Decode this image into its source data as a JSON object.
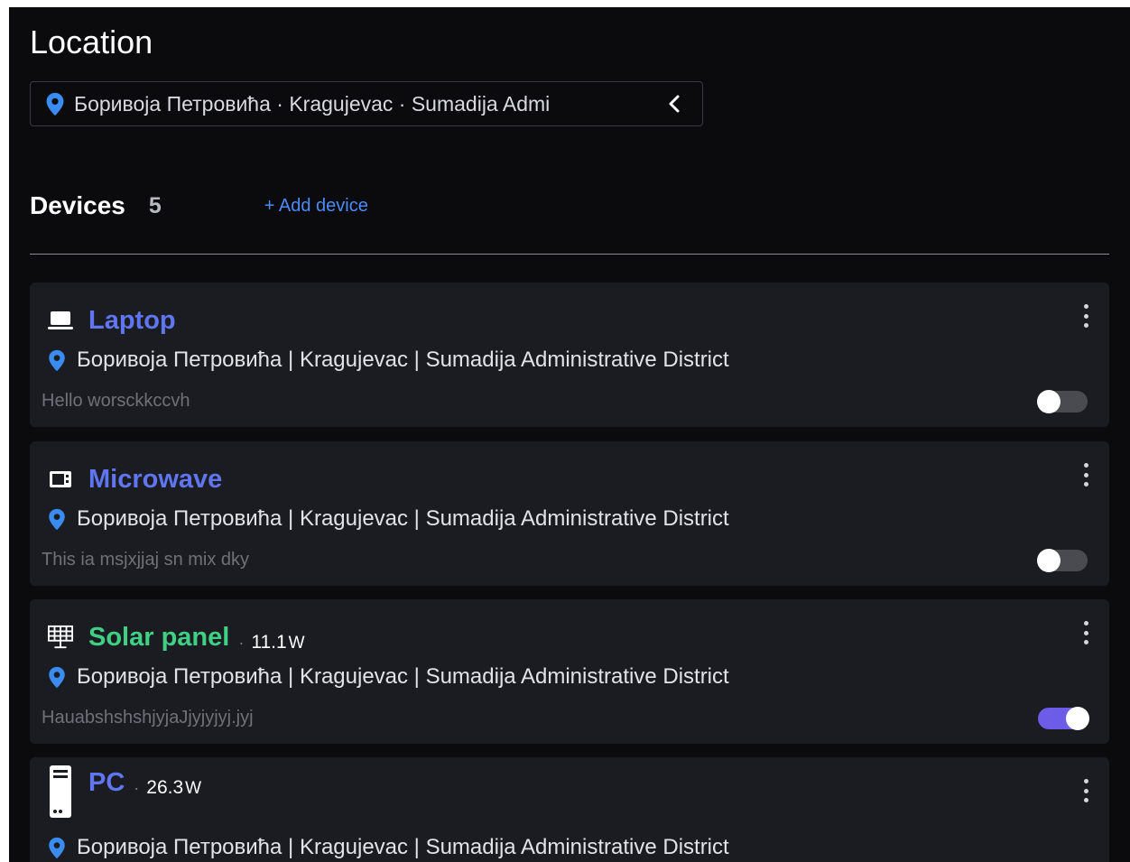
{
  "header": {
    "title": "Location"
  },
  "location_select": {
    "value": "Боривоја Петровића · Kragujevac · Sumadija Admi"
  },
  "devices": {
    "title": "Devices",
    "count": "5",
    "add_label": "+ Add device",
    "items": [
      {
        "name": "Laptop",
        "icon": "laptop-icon",
        "name_color": "#5f76f0",
        "address": "Боривоја Петровића | Kragujevac | Sumadija Administrative District",
        "description": "Hello worsckkccvh",
        "power": "",
        "power_unit": "",
        "enabled": false
      },
      {
        "name": "Microwave",
        "icon": "microwave-icon",
        "name_color": "#5f76f0",
        "address": "Боривоја Петровића | Kragujevac | Sumadija Administrative District",
        "description": "This ia msjxjjaj sn mix dky",
        "power": "",
        "power_unit": "",
        "enabled": false
      },
      {
        "name": "Solar panel",
        "icon": "solar-panel-icon",
        "name_color": "#3fd083",
        "address": "Боривоја Петровића | Kragujevac | Sumadija Administrative District",
        "description": "HauabshshshjyjaJjyjyjyj.jyj",
        "power": "11.1",
        "power_unit": "W",
        "enabled": true
      },
      {
        "name": "PC",
        "icon": "pc-icon",
        "name_color": "#5f76f0",
        "address": "Боривоја Петровића | Kragujevac | Sumadija Administrative District",
        "description": "",
        "power": "26.3",
        "power_unit": "W",
        "enabled": false
      }
    ]
  },
  "colors": {
    "background": "#0b0b0d",
    "card": "#1b1c22",
    "accent_blue": "#4a8cf7",
    "pin_blue": "#3b8cf0",
    "toggle_on": "#6c5ce7"
  }
}
